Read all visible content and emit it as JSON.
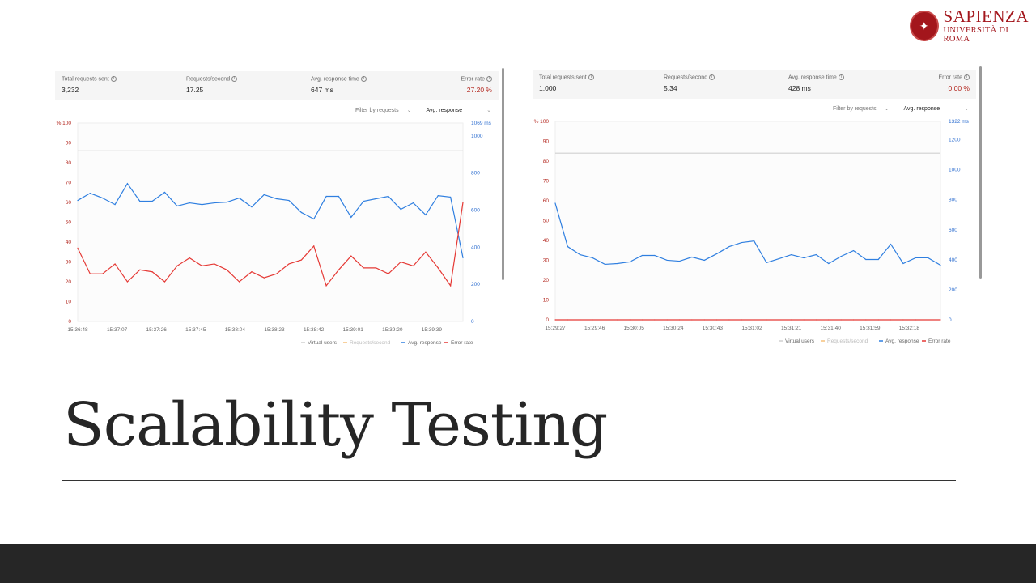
{
  "logo": {
    "name": "SAPIENZA",
    "subtitle": "UNIVERSITÀ DI ROMA"
  },
  "slide_title": "Scalability Testing",
  "panels": [
    {
      "stats": [
        {
          "label": "Total requests sent",
          "value": "3,232"
        },
        {
          "label": "Requests/second",
          "value": "17.25"
        },
        {
          "label": "Avg. response time",
          "value": "647 ms"
        },
        {
          "label": "Error rate",
          "value": "27.20 %"
        }
      ],
      "filter_label": "Filter by requests",
      "metric_select": "Avg. response"
    },
    {
      "stats": [
        {
          "label": "Total requests sent",
          "value": "1,000"
        },
        {
          "label": "Requests/second",
          "value": "5.34"
        },
        {
          "label": "Avg. response time",
          "value": "428 ms"
        },
        {
          "label": "Error rate",
          "value": "0.00 %"
        }
      ],
      "filter_label": "Filter by requests",
      "metric_select": "Avg. response"
    }
  ],
  "colors": {
    "virtual_users": "#d0d0d0",
    "requests_second": "#f5c07a",
    "avg_response": "#2f7fe0",
    "error_rate": "#e53935",
    "left_axis": "#b3261e",
    "right_axis": "#2f6fd0"
  },
  "chart_data": [
    {
      "type": "line",
      "title": "",
      "left_axis": {
        "label": "%",
        "max": 100,
        "ticks": [
          0,
          10,
          20,
          30,
          40,
          50,
          60,
          70,
          80,
          90,
          100
        ]
      },
      "right_axis": {
        "unit": "ms",
        "max": 1069,
        "top_label": "1069 ms",
        "ticks": [
          0,
          200,
          400,
          600,
          800,
          1000
        ]
      },
      "x_ticks": [
        "15:36:48",
        "15:37:07",
        "15:37:26",
        "15:37:45",
        "15:38:04",
        "15:38:23",
        "15:38:42",
        "15:39:01",
        "15:39:20",
        "15:39:39"
      ],
      "legend": [
        "Virtual users",
        "Requests/second",
        "Avg. response",
        "Error rate"
      ],
      "legend_position": "bottom-right",
      "series": [
        {
          "name": "Virtual users",
          "axis": "left",
          "values": [
            86,
            86
          ]
        },
        {
          "name": "Avg. response",
          "axis": "right",
          "values": [
            652,
            691,
            665,
            630,
            743,
            648,
            648,
            696,
            622,
            639,
            630,
            639,
            643,
            665,
            617,
            683,
            661,
            652,
            587,
            552,
            674,
            674,
            561,
            648,
            661,
            674,
            604,
            639,
            574,
            678,
            670,
            343
          ]
        },
        {
          "name": "Error rate",
          "axis": "left",
          "values": [
            37,
            24,
            24,
            29,
            20,
            26,
            25,
            20,
            28,
            32,
            28,
            29,
            26,
            20,
            25,
            22,
            24,
            29,
            31,
            38,
            18,
            26,
            33,
            27,
            27,
            24,
            30,
            28,
            35,
            27,
            18,
            60
          ]
        }
      ]
    },
    {
      "type": "line",
      "title": "",
      "left_axis": {
        "label": "%",
        "max": 100,
        "ticks": [
          0,
          10,
          20,
          30,
          40,
          50,
          60,
          70,
          80,
          90,
          100
        ]
      },
      "right_axis": {
        "unit": "ms",
        "max": 1322,
        "top_label": "1322 ms",
        "ticks": [
          0,
          200,
          400,
          600,
          800,
          1000,
          1200
        ]
      },
      "x_ticks": [
        "15:29:27",
        "15:29:46",
        "15:30:05",
        "15:30:24",
        "15:30:43",
        "15:31:02",
        "15:31:21",
        "15:31:40",
        "15:31:59",
        "15:32:18"
      ],
      "legend": [
        "Virtual users",
        "Requests/second",
        "Avg. response",
        "Error rate"
      ],
      "legend_position": "bottom-right",
      "series": [
        {
          "name": "Virtual users",
          "axis": "left",
          "values": [
            84,
            84
          ]
        },
        {
          "name": "Avg. response",
          "axis": "right",
          "values": [
            777,
            488,
            434,
            413,
            370,
            375,
            386,
            429,
            429,
            397,
            391,
            418,
            397,
            440,
            488,
            515,
            525,
            381,
            407,
            434,
            413,
            434,
            375,
            423,
            461,
            402,
            402,
            504,
            375,
            413,
            413,
            364
          ]
        },
        {
          "name": "Error rate",
          "axis": "left",
          "values": [
            0,
            0,
            0,
            0,
            0,
            0,
            0,
            0,
            0,
            0,
            0,
            0,
            0,
            0,
            0,
            0,
            0,
            0,
            0,
            0,
            0,
            0,
            0,
            0,
            0,
            0,
            0,
            0,
            0,
            0,
            0,
            0
          ]
        }
      ]
    }
  ]
}
